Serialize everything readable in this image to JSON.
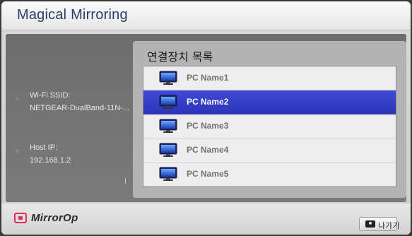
{
  "app": {
    "title": "Magical Mirroring"
  },
  "info": {
    "wifi_label": "Wi-Fi SSID:",
    "wifi_value": "NETGEAR-DualBand-11N-...",
    "host_label": "Host IP:",
    "host_value": "192.168.1.2"
  },
  "dialog": {
    "title": "연결장치 목록",
    "devices": [
      {
        "label": "PC Name1",
        "selected": false
      },
      {
        "label": "PC Name2",
        "selected": true
      },
      {
        "label": "PC Name3",
        "selected": false
      },
      {
        "label": "PC Name4",
        "selected": false
      },
      {
        "label": "PC Name5",
        "selected": false
      }
    ]
  },
  "footer": {
    "brand": "MirrorOp",
    "exit_label": "나가기"
  },
  "colors": {
    "accent": "#2f39c4",
    "brand": "#e0305a",
    "title": "#2c3e66"
  },
  "icons": {
    "device": "monitor-icon",
    "bullet": "bullet-icon",
    "exit": "exit-key-icon"
  }
}
